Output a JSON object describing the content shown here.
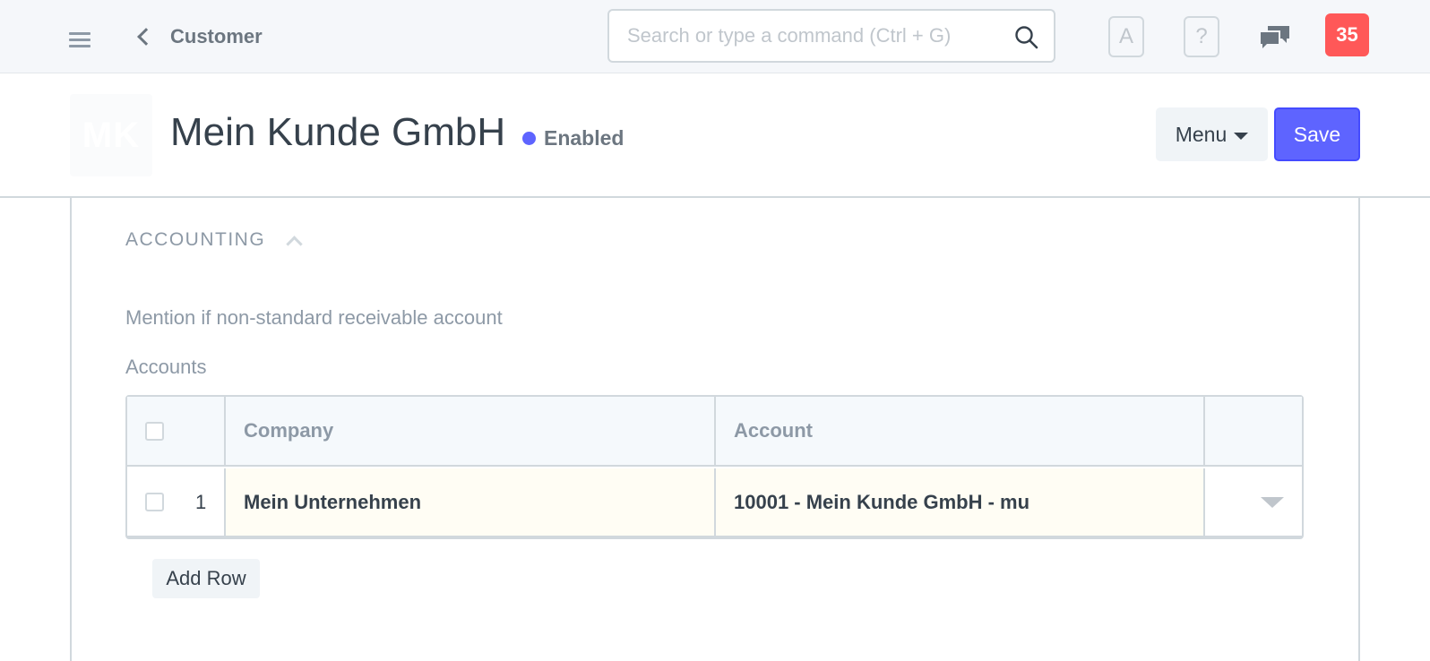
{
  "navbar": {
    "back_label": "Customer",
    "search_placeholder": "Search or type a command (Ctrl + G)",
    "avatar_btn_letter": "A",
    "help_btn_symbol": "?",
    "notification_count": "35"
  },
  "header": {
    "avatar_initials": "MK",
    "title": "Mein Kunde GmbH",
    "status": "Enabled",
    "menu_label": "Menu",
    "save_label": "Save"
  },
  "section": {
    "title": "ACCOUNTING",
    "description": "Mention if non-standard receivable account",
    "table_label": "Accounts",
    "columns": [
      "Company",
      "Account"
    ],
    "rows": [
      {
        "index": "1",
        "company": "Mein Unternehmen",
        "account": "10001 - Mein Kunde GmbH - mu"
      }
    ],
    "add_row_label": "Add Row"
  },
  "colors": {
    "primary": "#5e64ff",
    "danger": "#ff5858",
    "status_dot": "#5e64ff",
    "row_highlight": "#fffdf4"
  },
  "icons": [
    "hamburger-icon",
    "chevron-left-icon",
    "search-icon",
    "chat-icon",
    "chevron-up-icon",
    "caret-down-icon",
    "dropdown-caret-icon"
  ]
}
